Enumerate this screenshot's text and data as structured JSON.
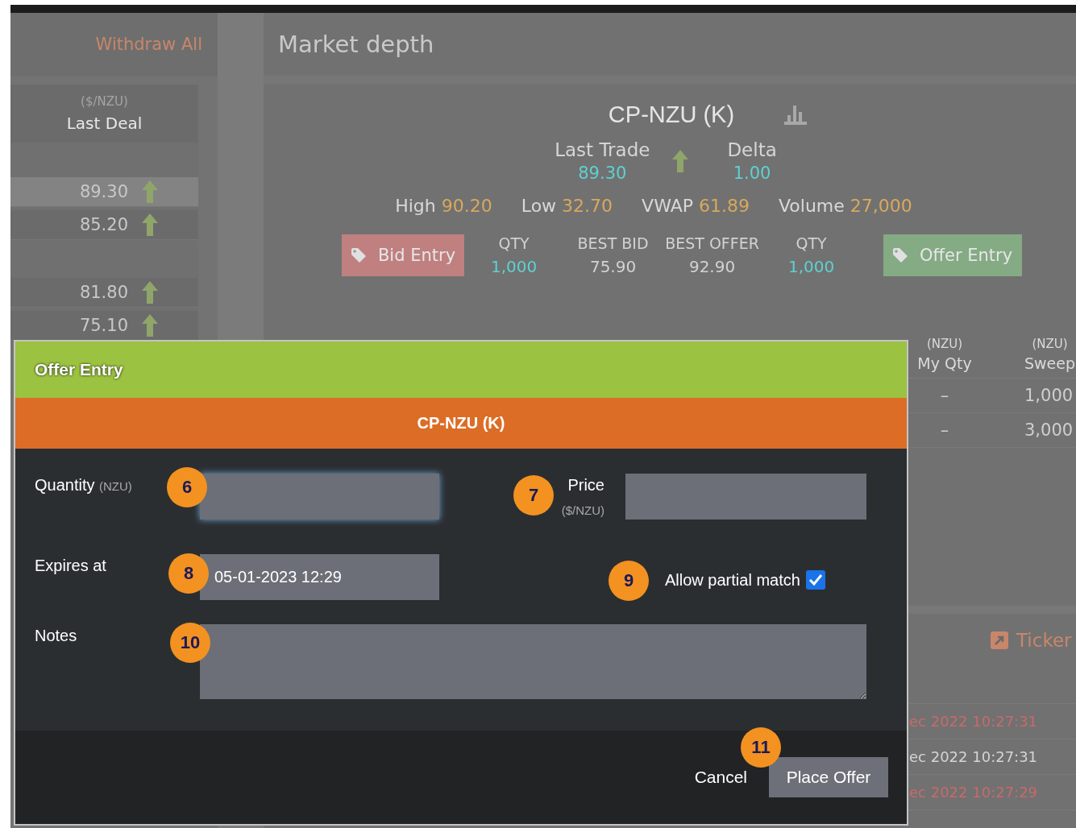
{
  "left_panel": {
    "action": "Withdraw All",
    "table": {
      "unit": "($/NZU)",
      "column": "Last Deal",
      "groups": [
        {
          "rows": [
            {
              "last_deal": "89.30",
              "selected": true
            },
            {
              "last_deal": "85.20",
              "selected": false
            }
          ]
        },
        {
          "rows": [
            {
              "last_deal": "81.80",
              "selected": false
            },
            {
              "last_deal": "75.10",
              "selected": false
            }
          ]
        }
      ]
    }
  },
  "market_depth": {
    "title": "Market depth",
    "instrument": "CP-NZU (K)",
    "last_trade": {
      "label": "Last Trade",
      "value": "89.30"
    },
    "delta": {
      "label": "Delta",
      "value": "1.00"
    },
    "stats": [
      {
        "label": "High",
        "value": "90.20"
      },
      {
        "label": "Low",
        "value": "32.70"
      },
      {
        "label": "VWAP",
        "value": "61.89"
      },
      {
        "label": "Volume",
        "value": "27,000"
      }
    ],
    "bid_button": "Bid Entry",
    "quotes": [
      {
        "label": "QTY",
        "value": "1,000",
        "kind": "qty"
      },
      {
        "label": "BEST BID",
        "value": "75.90",
        "kind": "price"
      },
      {
        "label": "BEST OFFER",
        "value": "92.90",
        "kind": "price"
      },
      {
        "label": "QTY",
        "value": "1,000",
        "kind": "qty"
      }
    ],
    "offer_button": "Offer Entry",
    "depth_table": {
      "columns": [
        {
          "unit": "(NZU)",
          "label": "My Qty"
        },
        {
          "unit": "(NZU)",
          "label": "Sweep"
        }
      ],
      "rows": [
        [
          "–",
          "1,000"
        ],
        [
          "–",
          "3,000"
        ]
      ]
    },
    "ticker": {
      "title": "Ticker",
      "rows": [
        {
          "text": "ec 2022 10:27:31",
          "color": "#c86a6a"
        },
        {
          "text": "ec 2022 10:27:31",
          "color": "#d4d4d4"
        },
        {
          "text": "ec 2022 10:27:29",
          "color": "#c86a6a"
        }
      ]
    }
  },
  "modal": {
    "title": "Offer Entry",
    "instrument": "CP-NZU (K)",
    "quantity": {
      "label": "Quantity",
      "unit": "(NZU)",
      "focused": true,
      "callout": "6"
    },
    "price": {
      "label": "Price",
      "unit": "($/NZU)",
      "callout": "7"
    },
    "expires": {
      "label": "Expires at",
      "value": "05-01-2023 12:29",
      "callout": "8"
    },
    "partial_match": {
      "label": "Allow partial match",
      "checked": true,
      "callout": "9"
    },
    "notes": {
      "label": "Notes",
      "callout": "10"
    },
    "cancel_button": "Cancel",
    "submit_button": {
      "label": "Place Offer",
      "callout": "11"
    }
  }
}
